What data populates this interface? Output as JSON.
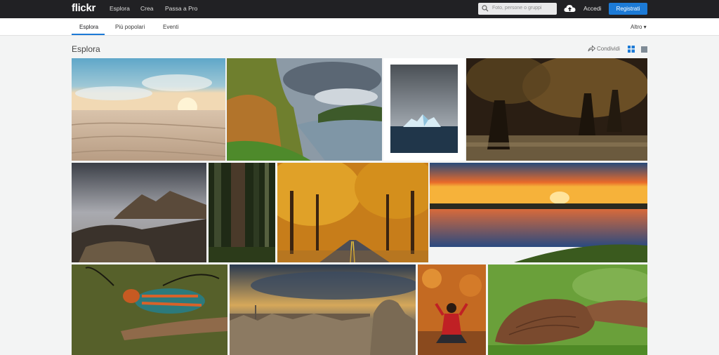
{
  "header": {
    "logo": "flickr",
    "nav": [
      "Esplora",
      "Crea",
      "Passa a Pro"
    ],
    "search_placeholder": "Foto, persone o gruppi",
    "login": "Accedi",
    "signup": "Registrati"
  },
  "subnav": {
    "tabs": [
      "Esplora",
      "Più popolari",
      "Eventi"
    ],
    "more": "Altro ▾"
  },
  "page": {
    "title": "Esplora",
    "share": "Condividi"
  },
  "colors": {
    "topbar": "#212124",
    "accent": "#1c7ad6"
  },
  "icons": {
    "search": "search-icon",
    "upload": "cloud-upload-icon",
    "share": "share-arrow-icon",
    "grid_view": "grid-view-icon",
    "single_view": "single-view-icon"
  }
}
